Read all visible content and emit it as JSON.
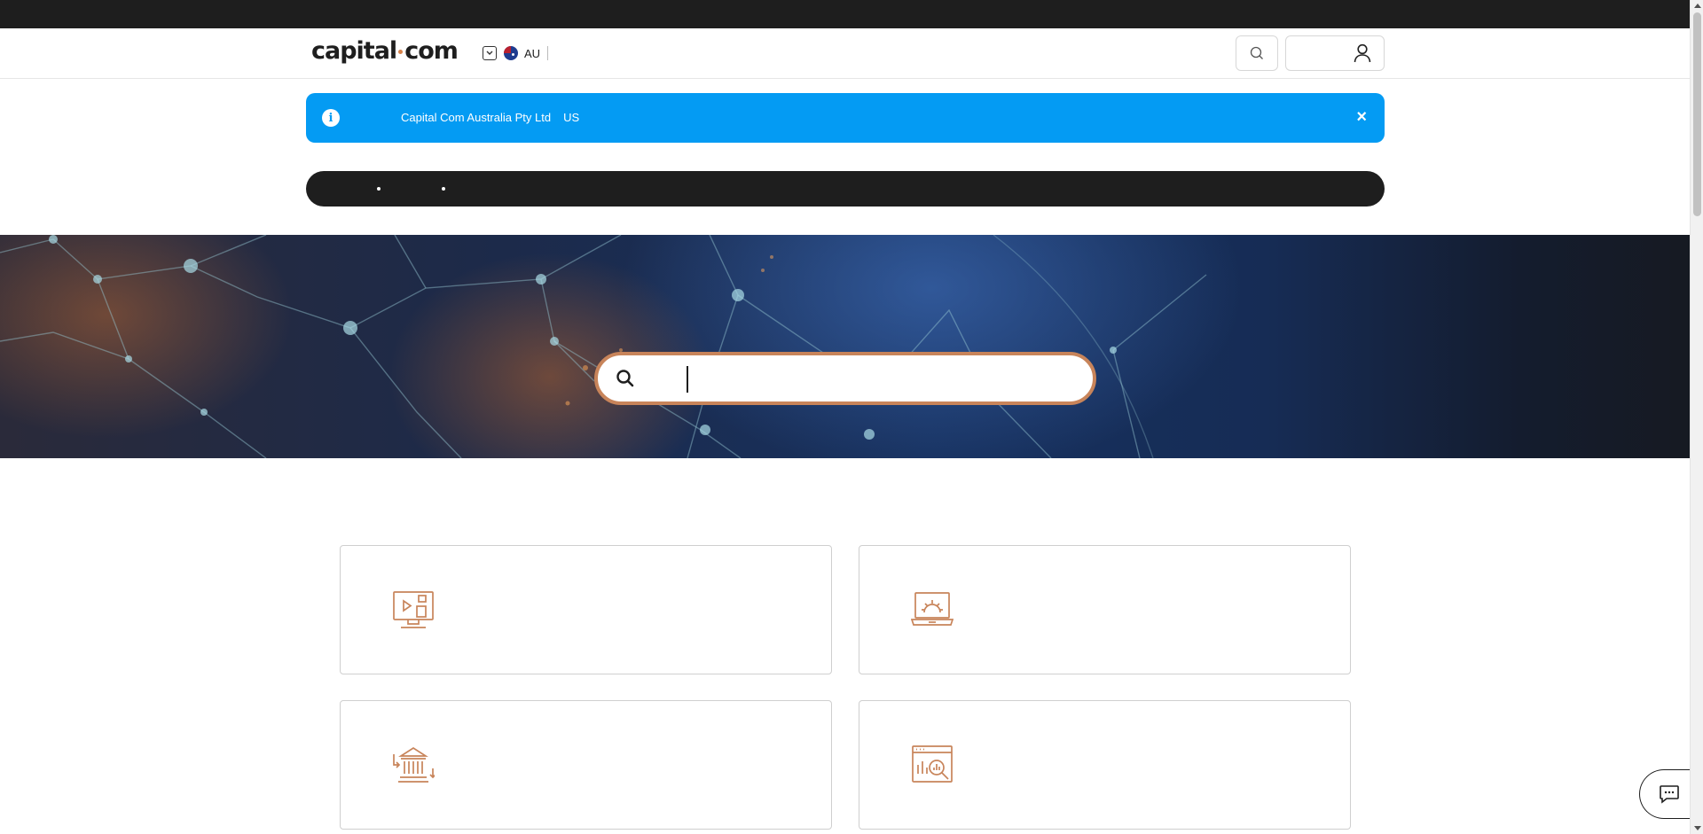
{
  "header": {
    "logo_text": "capital",
    "logo_text_2": "com",
    "region_code": "AU"
  },
  "banner": {
    "entity": "Capital Com Australia Pty Ltd",
    "region": "US",
    "close_symbol": "×",
    "info_symbol": "i"
  },
  "search": {
    "value": "",
    "placeholder": ""
  },
  "cards": [
    {
      "icon": "video-monitor-icon"
    },
    {
      "icon": "laptop-gear-icon"
    },
    {
      "icon": "bank-transfer-icon"
    },
    {
      "icon": "chart-analysis-icon"
    }
  ],
  "colors": {
    "accent": "#c8845a",
    "banner": "#049bf3",
    "dark": "#1e1e1e"
  }
}
